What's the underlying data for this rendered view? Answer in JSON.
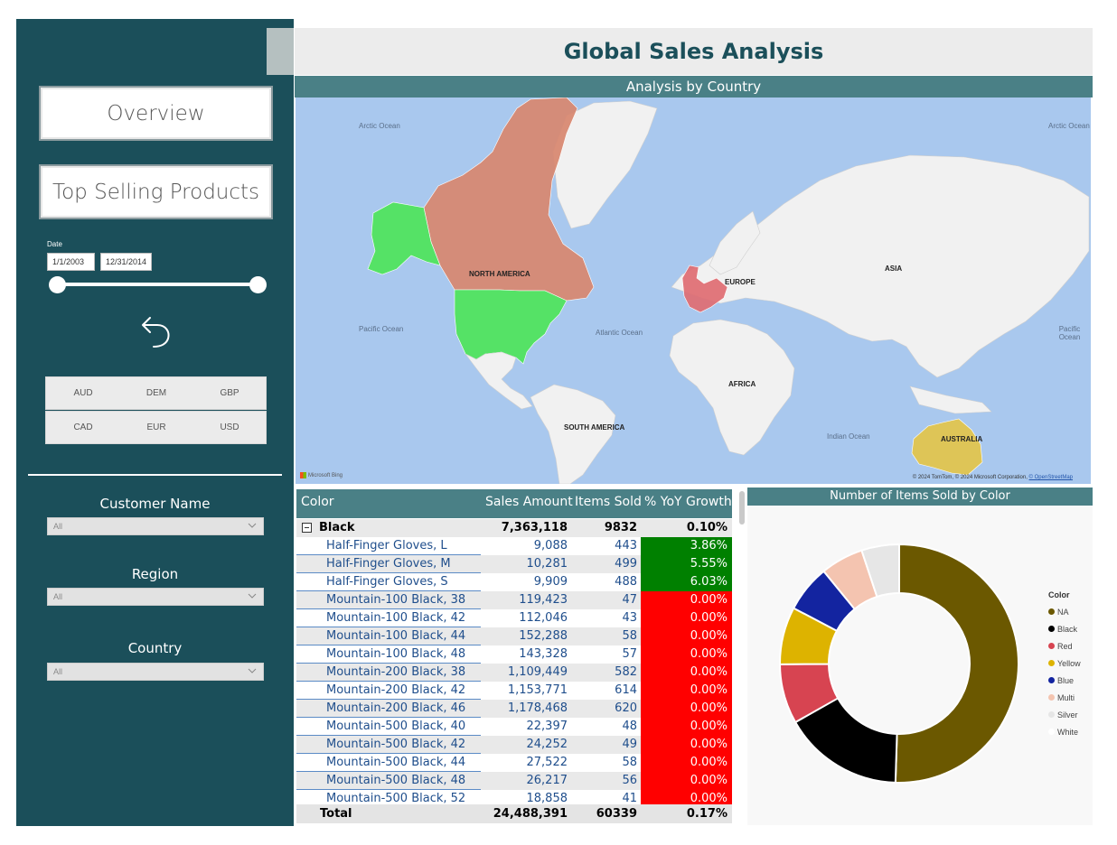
{
  "title": "Global Sales Analysis",
  "nav": {
    "overview": "Overview",
    "top_selling": "Top Selling Products"
  },
  "date_slicer": {
    "label": "Date",
    "start": "1/1/2003",
    "end": "12/31/2014"
  },
  "currencies": [
    "AUD",
    "DEM",
    "GBP",
    "CAD",
    "EUR",
    "USD"
  ],
  "filters": [
    {
      "title": "Customer Name",
      "value": "All"
    },
    {
      "title": "Region",
      "value": "All"
    },
    {
      "title": "Country",
      "value": "All"
    }
  ],
  "map": {
    "title": "Analysis by Country",
    "continents": [
      "NORTH AMERICA",
      "EUROPE",
      "ASIA",
      "AFRICA",
      "SOUTH AMERICA",
      "AUSTRALIA"
    ],
    "oceans": [
      "Arctic Ocean",
      "Arctic Ocean",
      "Pacific Ocean",
      "Atlantic Ocean",
      "Pacific Ocean",
      "Indian Ocean"
    ],
    "credit": "© 2024 TomTom, © 2024 Microsoft Corporation,",
    "credit_link": "© OpenStreetMap",
    "bing": "Microsoft Bing",
    "colors": {
      "canada": "#d8876f",
      "usa_alaska": "#4ee45a",
      "europe": "#e06d72",
      "australia": "#e3c44a"
    }
  },
  "table": {
    "headers": [
      "Color",
      "Sales Amount",
      "Items Sold",
      "% YoY Growth"
    ],
    "group": {
      "name": "Black",
      "sales": "7,363,118",
      "items": "9832",
      "yoy": "0.10%"
    },
    "rows": [
      {
        "name": "Half-Finger Gloves, L",
        "sales": "9,088",
        "items": "443",
        "yoy": "3.86%",
        "status": "up"
      },
      {
        "name": "Half-Finger Gloves, M",
        "sales": "10,281",
        "items": "499",
        "yoy": "5.55%",
        "status": "up"
      },
      {
        "name": "Half-Finger Gloves, S",
        "sales": "9,909",
        "items": "488",
        "yoy": "6.03%",
        "status": "up"
      },
      {
        "name": "Mountain-100 Black, 38",
        "sales": "119,423",
        "items": "47",
        "yoy": "0.00%",
        "status": "down"
      },
      {
        "name": "Mountain-100 Black, 42",
        "sales": "112,046",
        "items": "43",
        "yoy": "0.00%",
        "status": "down"
      },
      {
        "name": "Mountain-100 Black, 44",
        "sales": "152,288",
        "items": "58",
        "yoy": "0.00%",
        "status": "down"
      },
      {
        "name": "Mountain-100 Black, 48",
        "sales": "143,328",
        "items": "57",
        "yoy": "0.00%",
        "status": "down"
      },
      {
        "name": "Mountain-200 Black, 38",
        "sales": "1,109,449",
        "items": "582",
        "yoy": "0.00%",
        "status": "down"
      },
      {
        "name": "Mountain-200 Black, 42",
        "sales": "1,153,771",
        "items": "614",
        "yoy": "0.00%",
        "status": "down"
      },
      {
        "name": "Mountain-200 Black, 46",
        "sales": "1,178,468",
        "items": "620",
        "yoy": "0.00%",
        "status": "down"
      },
      {
        "name": "Mountain-500 Black, 40",
        "sales": "22,397",
        "items": "48",
        "yoy": "0.00%",
        "status": "down"
      },
      {
        "name": "Mountain-500 Black, 42",
        "sales": "24,252",
        "items": "49",
        "yoy": "0.00%",
        "status": "down"
      },
      {
        "name": "Mountain-500 Black, 44",
        "sales": "27,522",
        "items": "58",
        "yoy": "0.00%",
        "status": "down"
      },
      {
        "name": "Mountain-500 Black, 48",
        "sales": "26,217",
        "items": "56",
        "yoy": "0.00%",
        "status": "down"
      },
      {
        "name": "Mountain-500 Black, 52",
        "sales": "18,858",
        "items": "41",
        "yoy": "0.00%",
        "status": "down"
      }
    ],
    "total": {
      "label": "Total",
      "sales": "24,488,391",
      "items": "60339",
      "yoy": "0.17%"
    },
    "status_colors": {
      "up": "#008000",
      "down": "#ff0000"
    }
  },
  "chart_data": {
    "type": "pie",
    "title": "Number of Items Sold by Color",
    "legend_title": "Color",
    "legend_position": "right",
    "categories": [
      "NA",
      "Black",
      "Red",
      "Yellow",
      "Blue",
      "Multi",
      "Silver",
      "White"
    ],
    "values": [
      50.5,
      16.3,
      8.1,
      7.8,
      6.4,
      5.8,
      5.1,
      0
    ],
    "colors": [
      "#6b5800",
      "#000000",
      "#d74451",
      "#ddb300",
      "#1324a0",
      "#f4c4b0",
      "#e6e6e6",
      "#ffffff"
    ]
  }
}
